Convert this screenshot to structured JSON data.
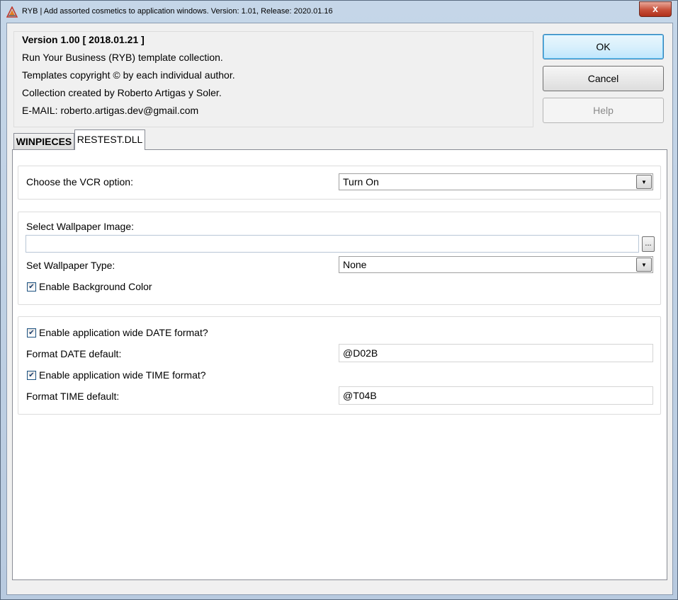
{
  "window": {
    "title": "RYB | Add assorted cosmetics to application windows. Version: 1.01, Release: 2020.01.16",
    "close_label": "x",
    "icon": "ryb-app-icon"
  },
  "info": {
    "version": "Version 1.00 [ 2018.01.21 ]",
    "line1": "Run Your Business (RYB) template collection.",
    "line2": "Templates copyright © by each individual author.",
    "line3": "Collection created by Roberto Artigas y Soler.",
    "line4": "E-MAIL: roberto.artigas.dev@gmail.com"
  },
  "buttons": {
    "ok": "OK",
    "cancel": "Cancel",
    "help": "Help"
  },
  "tabs": [
    {
      "label": "WINPIECES",
      "active": false
    },
    {
      "label": "RESTEST.DLL",
      "active": true
    }
  ],
  "vcr": {
    "label": "Choose the VCR option:",
    "value": "Turn On"
  },
  "wallpaper": {
    "image_label": "Select Wallpaper Image:",
    "image_value": "",
    "browse_label": "...",
    "type_label": "Set Wallpaper Type:",
    "type_value": "None",
    "bg_color_label": "Enable Background Color",
    "bg_color_checked": true
  },
  "formats": {
    "date_enable_label": "Enable application wide DATE format?",
    "date_enable_checked": true,
    "date_default_label": "Format DATE default:",
    "date_default_value": "@D02B",
    "time_enable_label": "Enable application wide TIME format?",
    "time_enable_checked": true,
    "time_default_label": "Format TIME default:",
    "time_default_value": "@T04B"
  },
  "check_glyph": "✔"
}
